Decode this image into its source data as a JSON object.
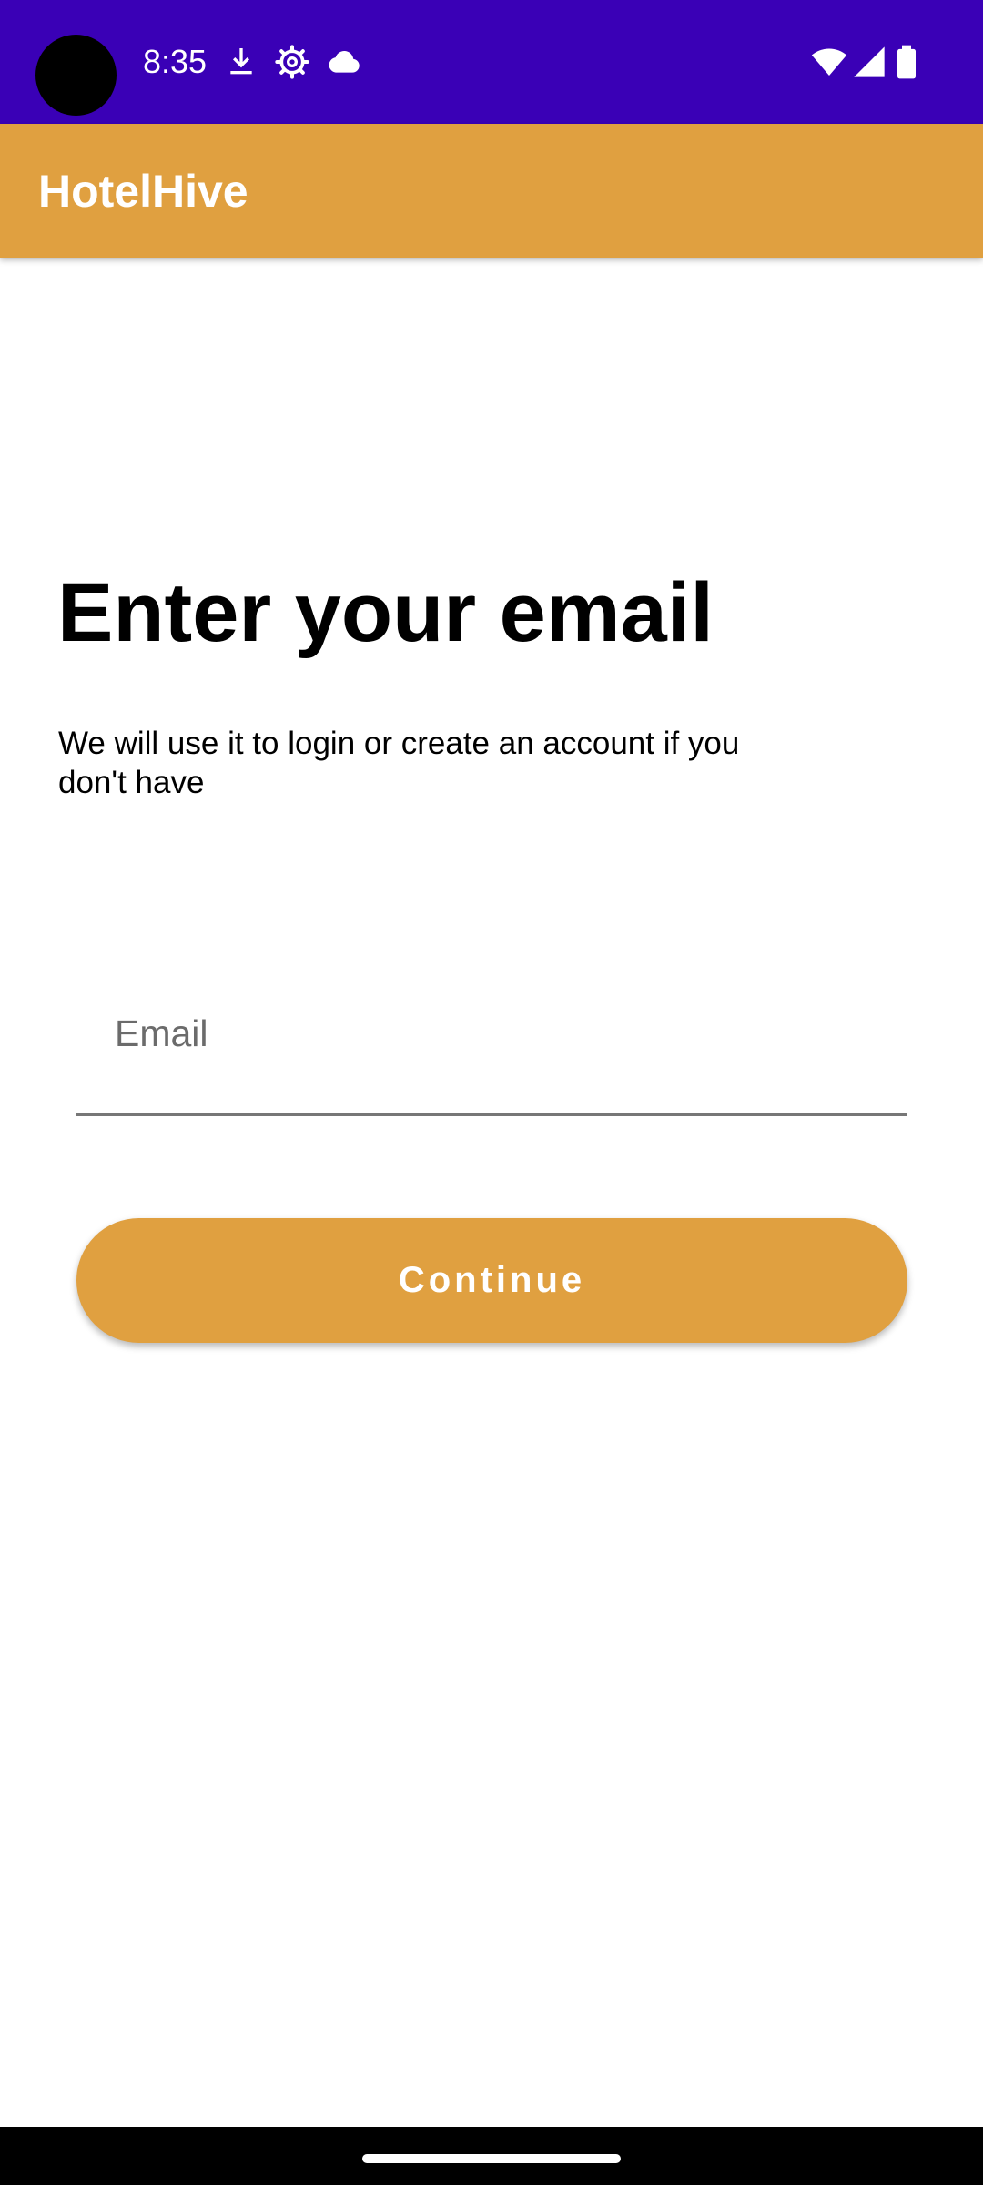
{
  "status_bar": {
    "time": "8:35",
    "left_icons": [
      "download-icon",
      "settings-gear-icon",
      "cloud-icon"
    ],
    "right_icons": [
      "wifi-icon",
      "cellular-signal-icon",
      "battery-icon"
    ],
    "background": "#3a00b6"
  },
  "app_bar": {
    "title": "HotelHive",
    "background": "#e0a040"
  },
  "main": {
    "heading": "Enter your email",
    "subtitle": "We will use it to login or create an account if you don't have",
    "email_field": {
      "placeholder": "Email",
      "value": ""
    },
    "continue_label": "Continue",
    "accent": "#e0a040"
  }
}
